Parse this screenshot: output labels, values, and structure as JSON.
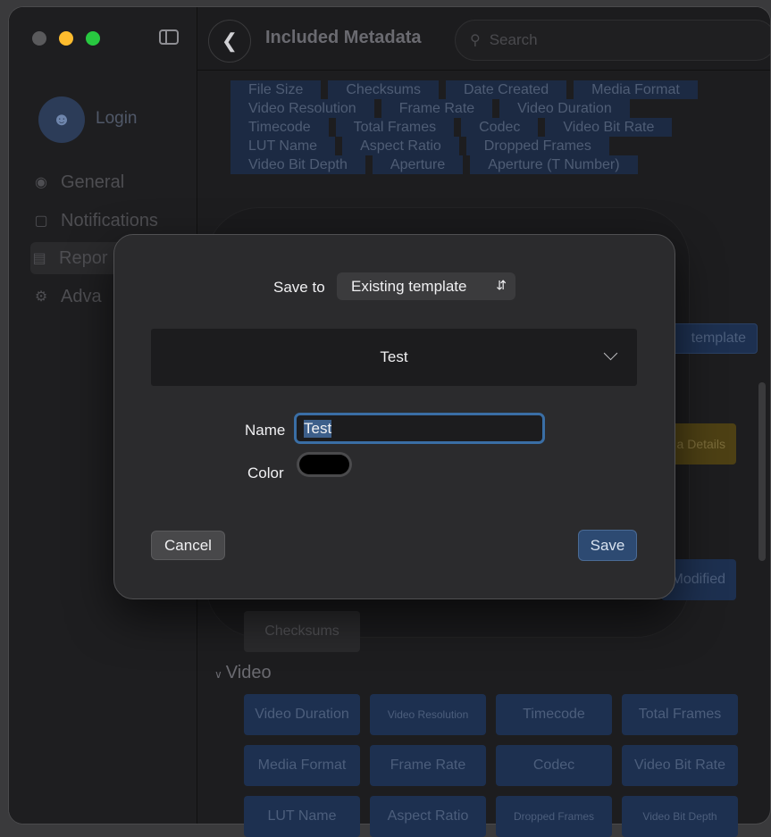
{
  "sidebar": {
    "login_label": "Login",
    "items": [
      {
        "label": "General",
        "icon": "gauge-icon"
      },
      {
        "label": "Notifications",
        "icon": "bell-badge-icon"
      },
      {
        "label": "Reports",
        "visible_text": "Repor",
        "icon": "document-icon"
      },
      {
        "label": "Advanced",
        "visible_text": "Adva",
        "icon": "gears-icon"
      }
    ]
  },
  "toolbar": {
    "title": "Included Metadata",
    "search_placeholder": "Search"
  },
  "included_metadata": [
    [
      "File Size",
      "Checksums",
      "Date Created",
      "Media Format"
    ],
    [
      "Video Resolution",
      "Frame Rate",
      "Video Duration"
    ],
    [
      "Timecode",
      "Total Frames",
      "Codec",
      "Video Bit Rate"
    ],
    [
      "LUT Name",
      "Aspect Ratio",
      "Dropped Frames"
    ],
    [
      "Video Bit Depth",
      "Aperture",
      "Aperture (T Number)"
    ]
  ],
  "background": {
    "template_button_partial": "template",
    "details_button_partial": "a Details",
    "modified_chip_partial": "Modified",
    "checksums_chip": "Checksums",
    "video_section_title": "Video",
    "video_chips": [
      "Video Duration",
      "Video Resolution",
      "Timecode",
      "Total Frames",
      "Media Format",
      "Frame Rate",
      "Codec",
      "Video Bit Rate",
      "LUT Name",
      "Aspect Ratio",
      "Dropped Frames",
      "Video Bit Depth"
    ]
  },
  "modal": {
    "save_to_label": "Save to",
    "save_to_value": "Existing template",
    "template_selected": "Test",
    "name_label": "Name",
    "name_value": "Test",
    "color_label": "Color",
    "color_value": "#000000",
    "cancel_label": "Cancel",
    "save_label": "Save"
  },
  "colors": {
    "accent": "#3a6ea5",
    "traffic_minimize": "#febc2e",
    "traffic_maximize": "#28c840"
  }
}
